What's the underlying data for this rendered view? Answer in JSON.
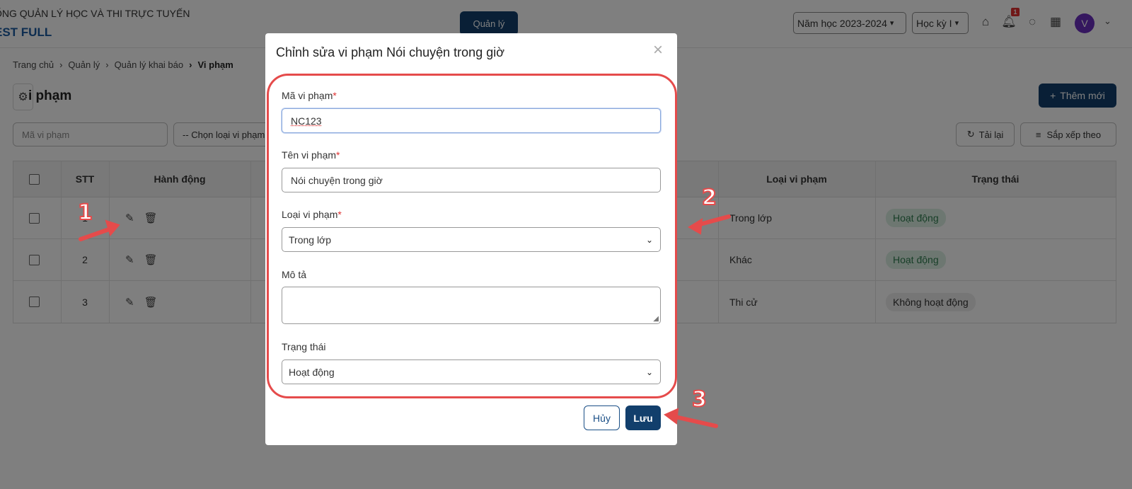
{
  "header": {
    "system_name": "ỐNG QUẢN LÝ HỌC VÀ THI TRỰC TUYẾN",
    "system_sub": "EST FULL",
    "tab_manage": "Quản lý",
    "school_year": "Năm học 2023-2024",
    "semester": "Học kỳ I",
    "notification_count": "1",
    "avatar_initial": "V"
  },
  "breadcrumb": [
    "Trang chủ",
    "Quản lý",
    "Quản lý khai báo",
    "Vi phạm"
  ],
  "page": {
    "title": "i phạm",
    "add_button": "Thêm mới",
    "filter_code_placeholder": "Mã vi phạm",
    "filter_type": "-- Chọn loại vi phạm",
    "reload_button": "Tải lại",
    "sort_button": "Sắp xếp theo"
  },
  "table": {
    "headers": {
      "stt": "STT",
      "actions": "Hành động",
      "type": "Loại vi phạm",
      "status": "Trạng thái"
    },
    "rows": [
      {
        "stt": "1",
        "type": "Trong lớp",
        "status": "Hoạt động",
        "active": true
      },
      {
        "stt": "2",
        "type": "Khác",
        "status": "Hoạt động",
        "active": true
      },
      {
        "stt": "3",
        "type": "Thi cử",
        "status": "Không hoạt động",
        "active": false
      }
    ]
  },
  "modal": {
    "title": "Chỉnh sửa vi phạm Nói chuyện trong giờ",
    "code_label": "Mã vi phạm",
    "code_value": "NC123",
    "name_label": "Tên vi phạm",
    "name_value": "Nói chuyện trong giờ",
    "type_label": "Loại vi phạm",
    "type_value": "Trong lớp",
    "desc_label": "Mô tả",
    "desc_value": "",
    "status_label": "Trạng thái",
    "status_value": "Hoạt động",
    "required_mark": "*",
    "cancel_button": "Hủy",
    "save_button": "Lưu"
  },
  "annotations": {
    "step1": "1",
    "step2": "2",
    "step3": "3"
  },
  "colors": {
    "primary": "#123f6c",
    "annotation": "#e54b4b",
    "active_badge": "#dbeee2"
  }
}
